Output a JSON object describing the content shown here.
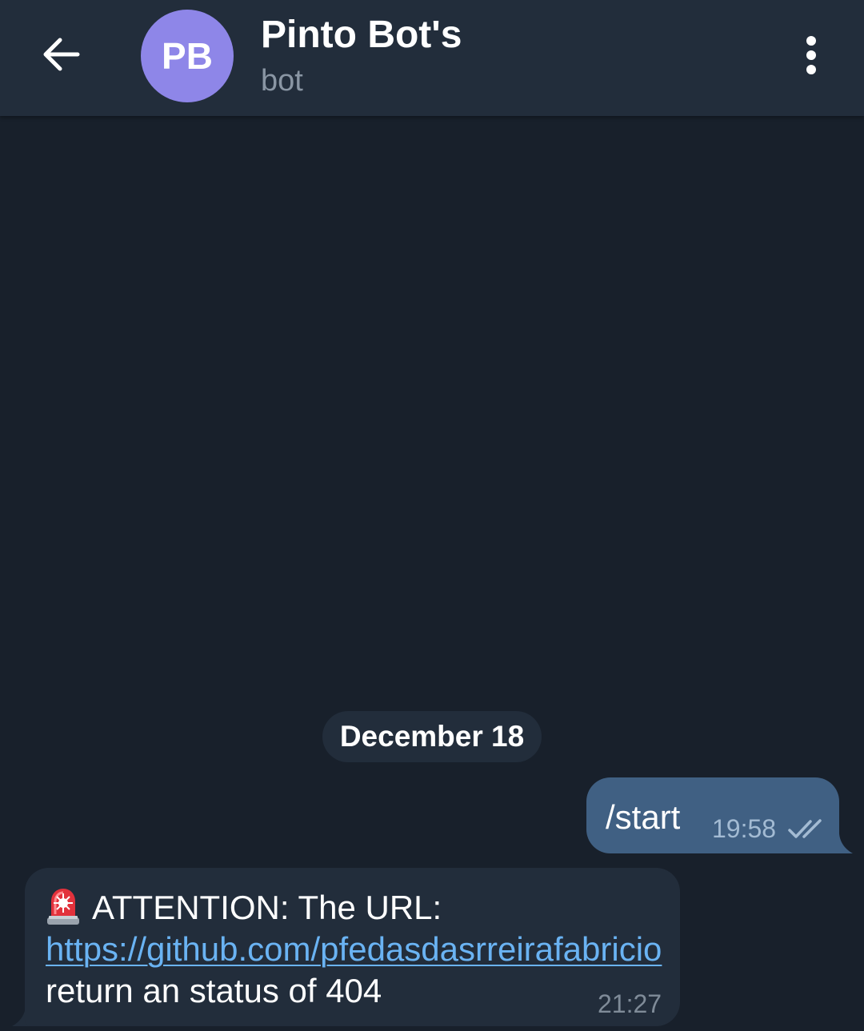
{
  "header": {
    "back_icon": "arrow-left-icon",
    "avatar_initials": "PB",
    "avatar_color": "#8e86e8",
    "title": "Pinto Bot's",
    "subtitle": "bot",
    "menu_icon": "more-vertical-icon"
  },
  "chat": {
    "date_separator": "December 18",
    "messages": [
      {
        "direction": "outgoing",
        "text": "/start",
        "time": "19:58",
        "status_icon": "double-check-icon"
      },
      {
        "direction": "incoming",
        "emoji_icon": "siren-icon",
        "text_before_link": "ATTENTION: The URL: ",
        "link_text": "https://github.com/pfedasdasrreirafabricio",
        "text_after_link": " return an status of 404",
        "time": "21:27"
      }
    ]
  },
  "colors": {
    "background": "#18202b",
    "header": "#222d3b",
    "outgoing_bubble": "#406083",
    "incoming_bubble": "#222d3b",
    "link": "#6ab3f3"
  }
}
